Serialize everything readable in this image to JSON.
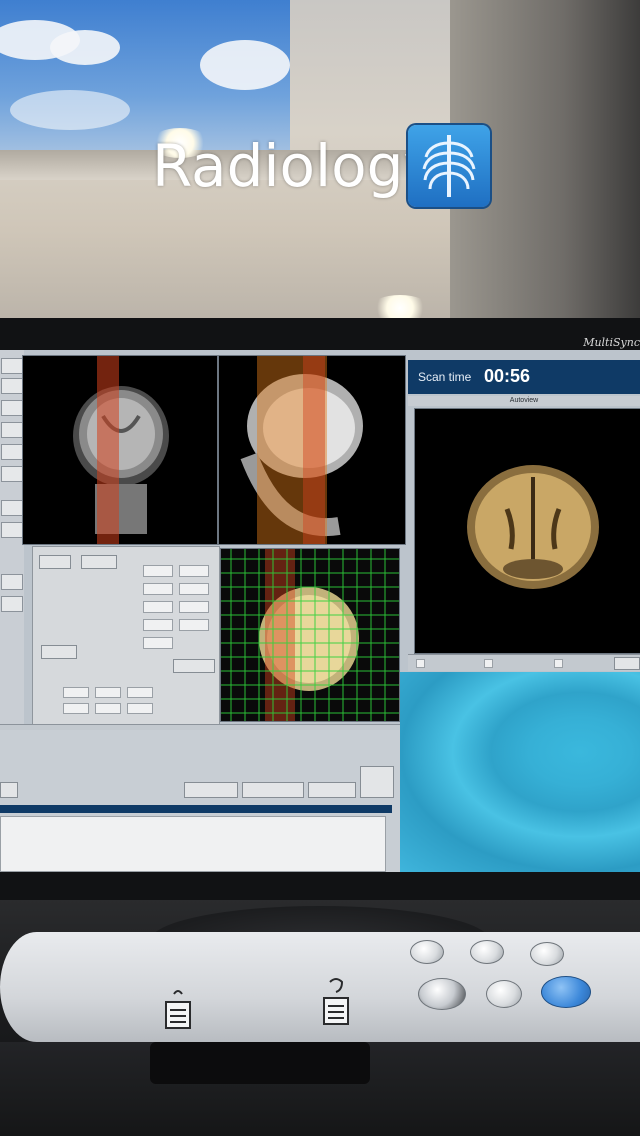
{
  "overlay": {
    "title": "Radiology",
    "icon": "ribcage-xray-icon",
    "icon_color": "#2f8ad6"
  },
  "monitor": {
    "brand": "MultiSync",
    "scan_panel": {
      "label": "Scan time",
      "value": "00:56"
    },
    "autoview_label": "Autoview"
  },
  "colors": {
    "header_navy": "#0f3a66",
    "ui_gray": "#bcc4cc",
    "screensaver_cyan": "#3ab8dd",
    "start_button_blue": "#3b87d9"
  }
}
